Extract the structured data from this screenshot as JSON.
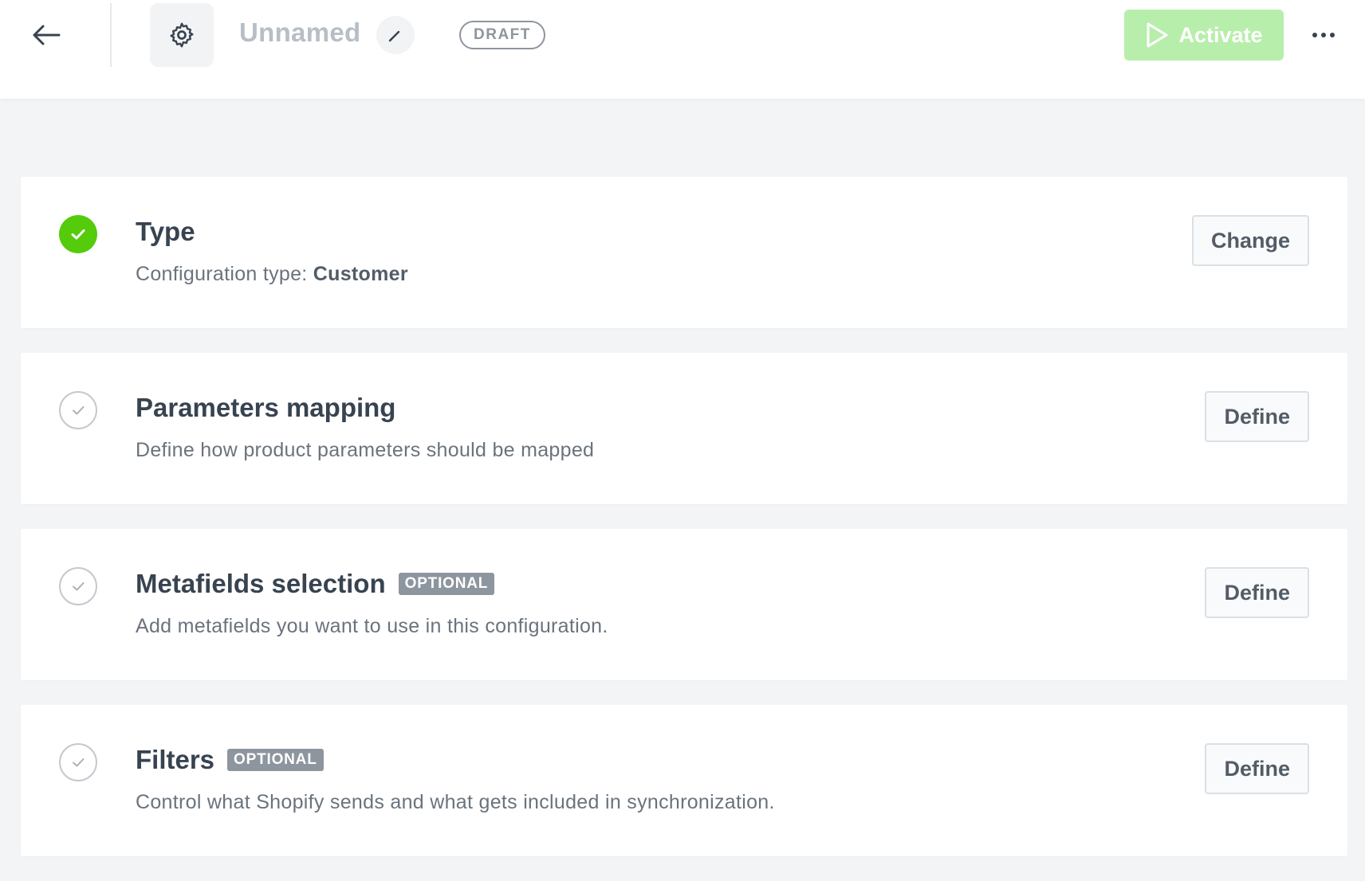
{
  "header": {
    "back_icon": "arrow-left-icon",
    "settings_icon": "gear-icon",
    "title": "Unnamed",
    "edit_icon": "pencil-icon",
    "status_badge": "DRAFT",
    "activate_label": "Activate",
    "activate_icon": "play-icon",
    "more_icon": "more-horizontal-icon"
  },
  "steps": [
    {
      "title": "Type",
      "optional_label": "",
      "description_prefix": "Configuration type: ",
      "description_value": "Customer",
      "button_label": "Change",
      "status": "done"
    },
    {
      "title": "Parameters mapping",
      "optional_label": "",
      "description_prefix": "Define how product parameters should be mapped",
      "description_value": "",
      "button_label": "Define",
      "status": "todo"
    },
    {
      "title": "Metafields selection",
      "optional_label": "OPTIONAL",
      "description_prefix": "Add metafields you want to use in this configuration.",
      "description_value": "",
      "button_label": "Define",
      "status": "todo"
    },
    {
      "title": "Filters",
      "optional_label": "OPTIONAL",
      "description_prefix": "Control what Shopify sends and what gets included in synchronization.",
      "description_value": "",
      "button_label": "Define",
      "status": "todo"
    }
  ],
  "colors": {
    "accent_green": "#54cb0b",
    "activate_disabled": "#b7eeab",
    "badge_gray": "#8d959e",
    "text_primary": "#384350"
  }
}
